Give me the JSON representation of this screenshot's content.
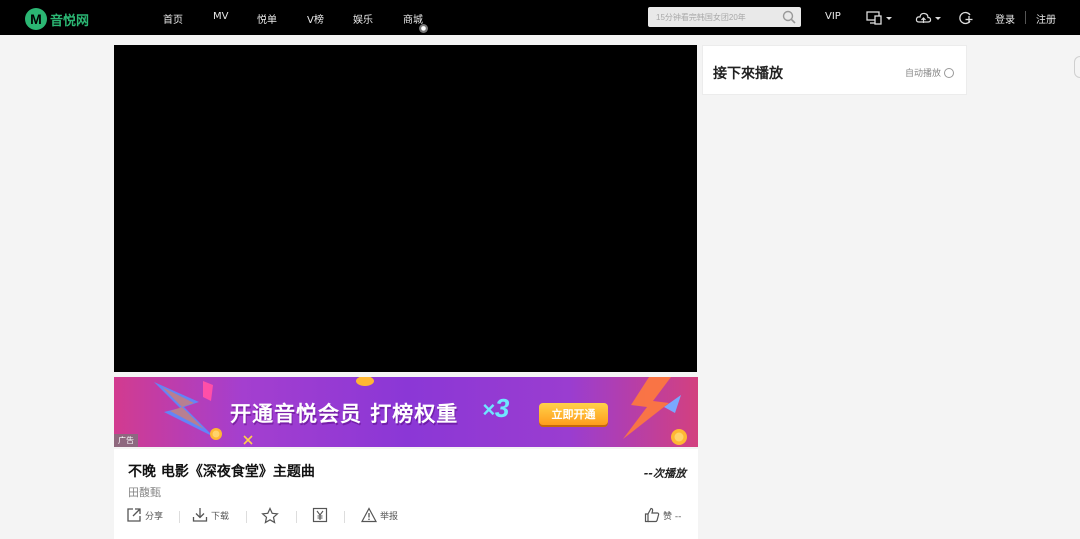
{
  "site": {
    "logo_mark": "M",
    "logo_text": "音悦网"
  },
  "nav": {
    "items": [
      {
        "label": "首页"
      },
      {
        "label": "MV"
      },
      {
        "label": "悦单"
      },
      {
        "label": "V榜"
      },
      {
        "label": "娱乐"
      },
      {
        "label": "商城"
      }
    ]
  },
  "search": {
    "placeholder": "15分钟看完韩国女团20年"
  },
  "header_right": {
    "vip_label": "VIP",
    "login_label": "登录",
    "register_label": "注册",
    "icons": [
      "device-icon",
      "cloud-upload-icon",
      "refresh-plus-icon"
    ]
  },
  "banner": {
    "headline": "开通音悦会员  打榜权重",
    "multiplier_x": "×",
    "multiplier_n": "3",
    "cta_label": "立即开通",
    "ad_label": "广告"
  },
  "song": {
    "title": "不晚 电影《深夜食堂》主题曲",
    "artist": "田馥甄",
    "play_count": "--次播放",
    "actions": {
      "share": "分享",
      "download": "下载",
      "like": "赞 --"
    }
  },
  "upnext": {
    "title": "接下來播放",
    "autoplay_label": "自动播放"
  },
  "colors": {
    "topbar": "#000000",
    "brand_green": "#2bb673",
    "banner_purple": "#8b37d6",
    "cta_orange": "#ff9d1c"
  }
}
